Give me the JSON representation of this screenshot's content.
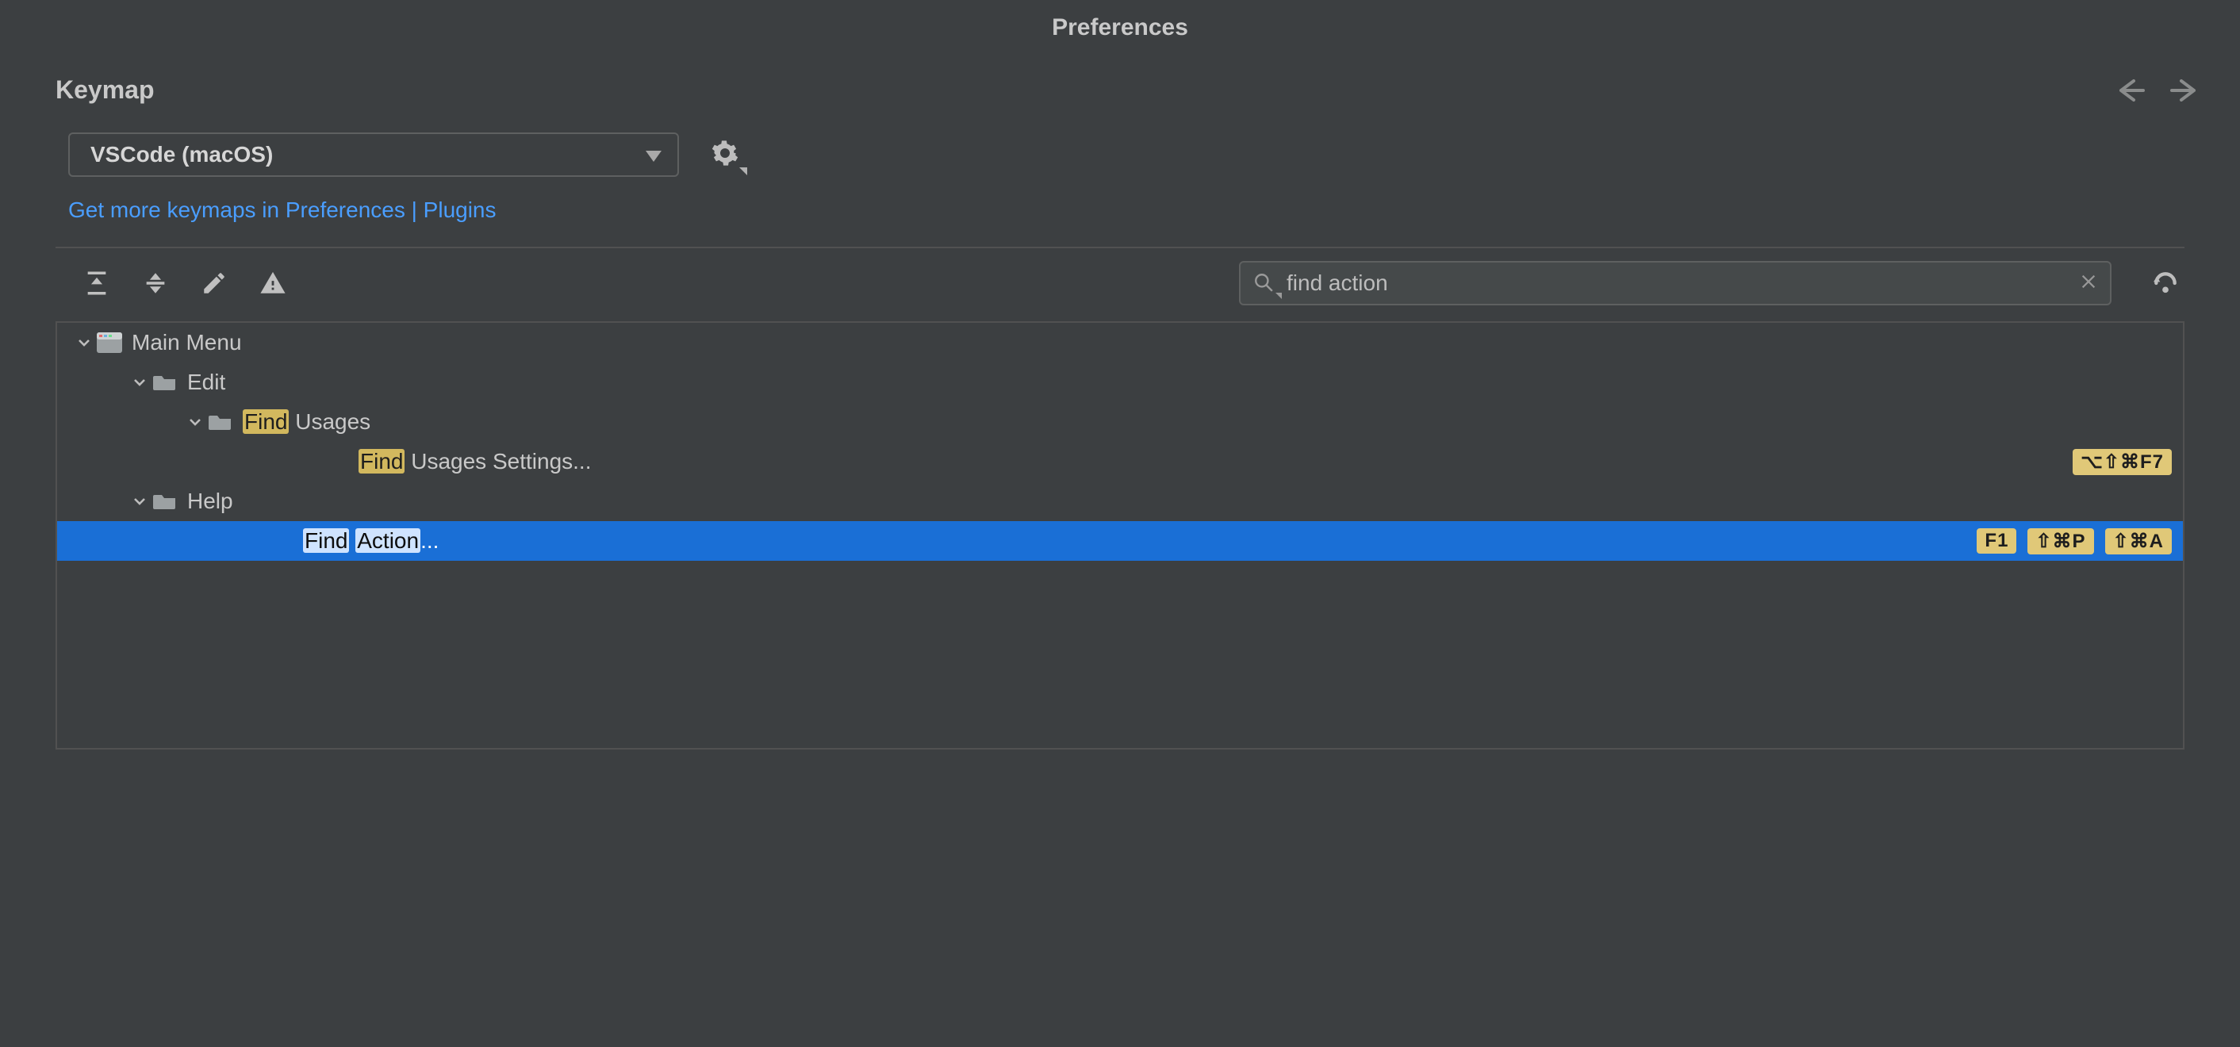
{
  "window": {
    "title": "Preferences"
  },
  "page": {
    "heading": "Keymap"
  },
  "keymap_dropdown": {
    "selected": "VSCode (macOS)"
  },
  "plugins_link": {
    "text": "Get more keymaps in Preferences | Plugins"
  },
  "search": {
    "value": "find action",
    "placeholder": ""
  },
  "tree": {
    "root": {
      "label": "Main Menu",
      "expanded": true,
      "children": [
        {
          "label": "Edit",
          "expanded": true,
          "children": [
            {
              "label_prefix_hl": "Find",
              "label_rest": " Usages",
              "expanded": true,
              "children": [
                {
                  "label_prefix_hl": "Find",
                  "label_rest": " Usages Settings...",
                  "shortcuts": [
                    "⌥⇧⌘F7"
                  ]
                }
              ]
            }
          ]
        },
        {
          "label": "Help",
          "expanded": true,
          "children": [
            {
              "label_hl1": "Find",
              "label_mid": " ",
              "label_hl2": "Action",
              "label_rest": "...",
              "selected": true,
              "shortcuts": [
                "F1",
                "⇧⌘P",
                "⇧⌘A"
              ]
            }
          ]
        }
      ]
    }
  }
}
